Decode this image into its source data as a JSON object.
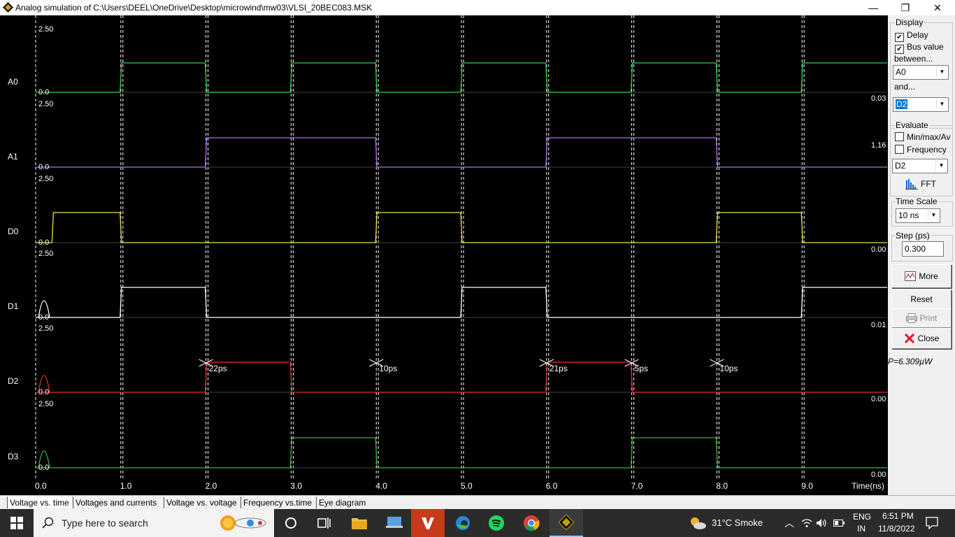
{
  "window": {
    "title": "Analog simulation of C:\\Users\\DEEL\\OneDrive\\Desktop\\microwind\\mw03\\VLSI_20BEC083.MSK",
    "minimize": "—",
    "maximize": "❐",
    "close": "✕"
  },
  "plot": {
    "signals": [
      {
        "name": "A0",
        "vmax": "2.50",
        "vmin": "0.0",
        "right_value": "0.03",
        "color": "#3cd04a"
      },
      {
        "name": "A1",
        "vmax": "2.50",
        "vmin": "0.0",
        "right_value": "1.16",
        "color": "#b070e8"
      },
      {
        "name": "D0",
        "vmax": "2.50",
        "vmin": "0.0",
        "right_value": "0.00",
        "color": "#e8e048"
      },
      {
        "name": "D1",
        "vmax": "2.50",
        "vmin": "0.0",
        "right_value": "0.01",
        "color": "#ffffff"
      },
      {
        "name": "D2",
        "vmax": "2.50",
        "vmin": "0.0",
        "right_value": "0.00",
        "color": "#e03030"
      },
      {
        "name": "D3",
        "vmax": "2.50",
        "vmin": "0.0",
        "right_value": "0.00",
        "color": "#3cb040"
      }
    ],
    "time_ticks": [
      "0.0",
      "1.0",
      "2.0",
      "3.0",
      "4.0",
      "5.0",
      "6.0",
      "7.0",
      "8.0",
      "9.0"
    ],
    "time_axis_label": "Time(ns)",
    "delays": [
      {
        "t": 2.0,
        "label": "22ps"
      },
      {
        "t": 4.0,
        "label": "10ps"
      },
      {
        "t": 6.0,
        "label": "21ps"
      },
      {
        "t": 7.0,
        "label": "5ps"
      },
      {
        "t": 8.0,
        "label": "10ps"
      }
    ]
  },
  "panel": {
    "display_label": "Display",
    "delay_label": "Delay",
    "delay_checked": true,
    "bus_value_label": "Bus value",
    "bus_value_checked": true,
    "between_label": "between...",
    "between_value": "A0",
    "and_label": "and...",
    "and_value": "D2",
    "evaluate_label": "Evaluate",
    "minmax_label": "Min/max/Av",
    "minmax_checked": false,
    "frequency_label": "Frequency",
    "frequency_checked": false,
    "evaluate_signal": "D2",
    "fft_label": "FFT",
    "timescale_label": "Time Scale",
    "timescale_value": "10 ns",
    "step_label": "Step (ps)",
    "step_value": "0.300",
    "more_label": "More",
    "reset_label": "Reset",
    "print_label": "Print",
    "close_label": "Close",
    "power": "P=6.309µW"
  },
  "tabs": [
    "Voltage vs. time",
    "Voltages and currents",
    "Voltage vs. voltage",
    "Frequency vs.time",
    "Eye diagram"
  ],
  "taskbar": {
    "search_placeholder": "Type here to search",
    "weather": "31°C  Smoke",
    "lang_top": "ENG",
    "lang_bottom": "IN",
    "time": "6:51 PM",
    "date": "11/8/2022"
  },
  "colors": {
    "plot_background": "#000000",
    "panel_background": "#f0f0f0",
    "taskbar": "#2b2b2b",
    "close_red": "#e81123"
  }
}
